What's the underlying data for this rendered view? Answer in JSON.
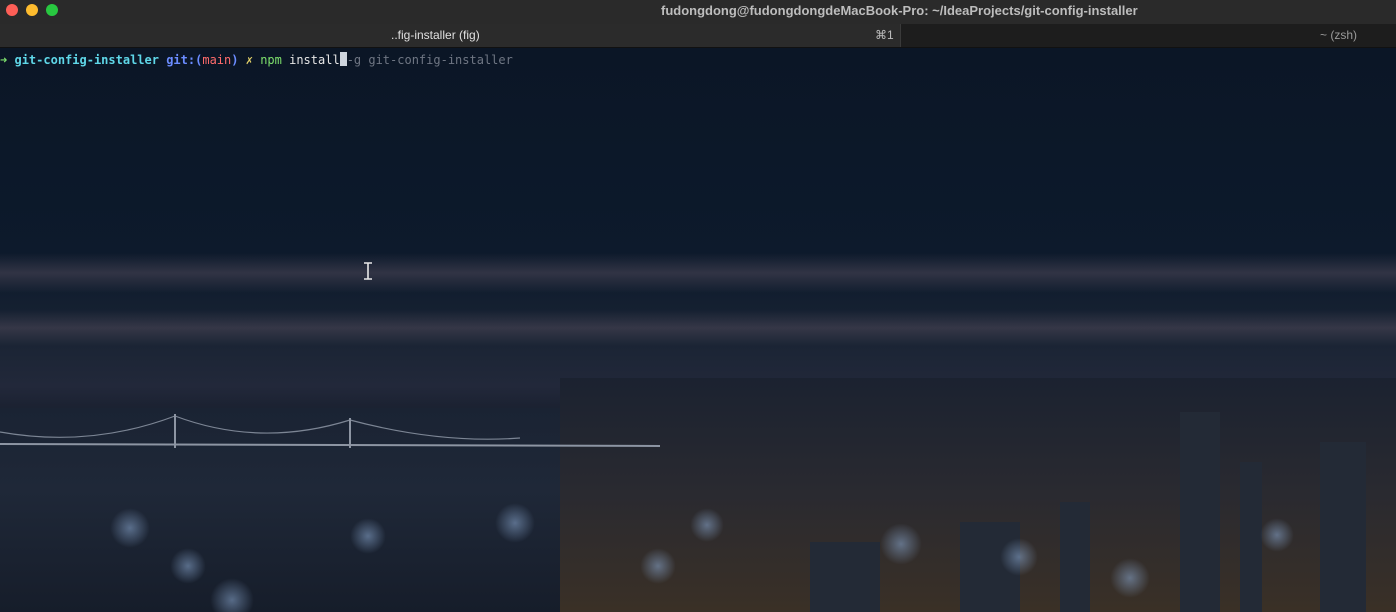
{
  "window": {
    "title": "fudongdong@fudongdongdeMacBook-Pro: ~/IdeaProjects/git-config-installer"
  },
  "tabs": [
    {
      "label": "..fig-installer (fig)",
      "shortcut": "⌘1",
      "active": true
    },
    {
      "label": "~ (zsh)",
      "active": false
    }
  ],
  "terminal": {
    "prompt_arrow": "➜",
    "directory": "git-config-installer",
    "git_label": "git:",
    "branch_open": "(",
    "branch": "main",
    "branch_close": ")",
    "dirty_marker": "✗",
    "command": "npm",
    "typed_args": "install",
    "autosuggestion": "-g git-config-installer"
  },
  "colors": {
    "close": "#fe5f57",
    "minimize": "#febc2e",
    "maximize": "#28c840",
    "prompt_arrow": "#7ee06c",
    "directory": "#5fd7e8",
    "git_label": "#6b8cff",
    "branch": "#ff6b6b",
    "suggestion": "#6f7683"
  }
}
